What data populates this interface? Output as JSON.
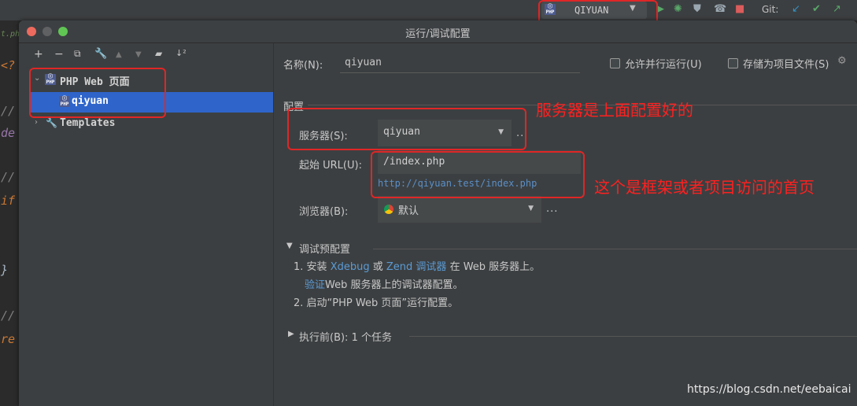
{
  "toolbar": {
    "run_config_name": "QIYUAN",
    "git_label": "Git:"
  },
  "editor_fragments": [
    "<?",
    "//",
    "de",
    "//",
    "if",
    "}",
    "//",
    "re",
    "t.ph"
  ],
  "dialog": {
    "title": "运行/调试配置",
    "tree": {
      "group_label": "PHP Web 页面",
      "item_label": "qiyuan",
      "templates_label": "Templates"
    },
    "name_label": "名称(N):",
    "name_value": "qiyuan",
    "allow_parallel_label": "允许并行运行(U)",
    "store_as_project_label": "存储为项目文件(S)",
    "config_section": "配置",
    "server_label": "服务器(S):",
    "server_value": "qiyuan",
    "start_url_label": "起始 URL(U):",
    "start_url_value": "/index.php",
    "start_url_hint": "http://qiyuan.test/index.php",
    "browser_label": "浏览器(B):",
    "browser_value": "默认",
    "debug_preconfig_title": "调试预配置",
    "step1_prefix": "1. 安装",
    "xdebug": "Xdebug",
    "or": "或",
    "zend_debugger": "Zend 调试器",
    "step1_suffix": "在 Web 服务器上。",
    "verify_link": "验证",
    "verify_suffix": "Web 服务器上的调试器配置。",
    "step2": "2. 启动“PHP Web 页面”运行配置。",
    "before_launch": "执行前(B): 1 个任务"
  },
  "annotations": {
    "server_note": "服务器是上面配置好的",
    "url_note": "这个是框架或者项目访问的首页",
    "watermark": "https://blog.csdn.net/eebaicai"
  },
  "colors": {
    "selection": "#2f65ca",
    "link": "#5b9bd5",
    "annotation_red": "#e02626"
  }
}
